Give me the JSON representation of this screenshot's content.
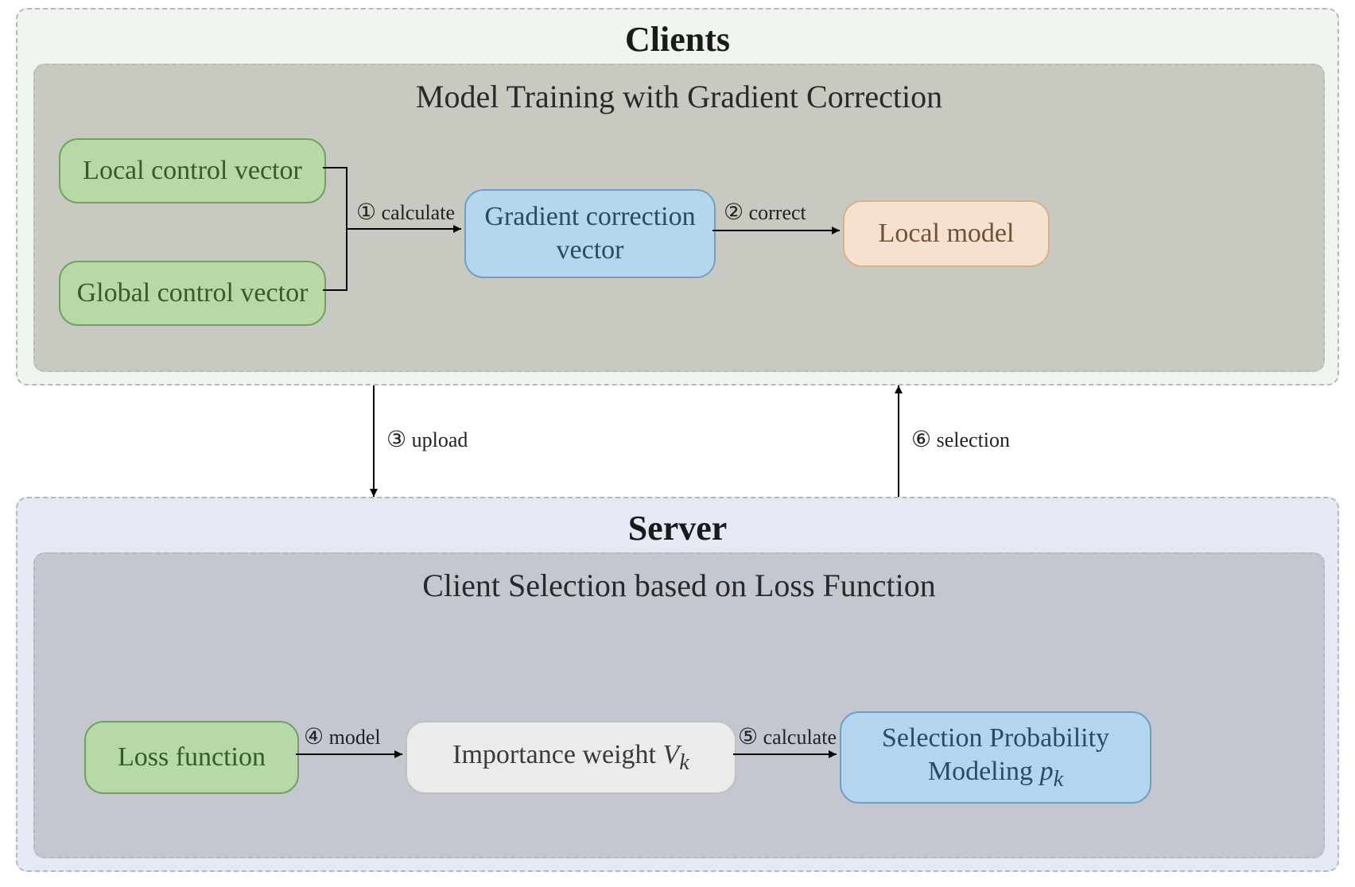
{
  "sections": {
    "clients": {
      "title": "Clients",
      "panel_title": "Model Training with Gradient Correction",
      "nodes": {
        "local_cv": "Local control vector",
        "global_cv": "Global control vector",
        "grad_vec_l1": "Gradient correction",
        "grad_vec_l2": "vector",
        "local_model": "Local model"
      }
    },
    "server": {
      "title": "Server",
      "panel_title": "Client Selection based on Loss Function",
      "nodes": {
        "loss": "Loss function",
        "importance_prefix": "Importance weight ",
        "importance_var": "V",
        "importance_sub": "k",
        "selprob_l1": "Selection Probability",
        "selprob_l2_prefix": "Modeling ",
        "selprob_var": "p",
        "selprob_sub": "k"
      }
    }
  },
  "edges": {
    "step1": {
      "num": "①",
      "label": "calculate"
    },
    "step2": {
      "num": "②",
      "label": "correct"
    },
    "step3": {
      "num": "③",
      "label": "upload"
    },
    "step4": {
      "num": "④",
      "label": "model"
    },
    "step5": {
      "num": "⑤",
      "label": "calculate"
    },
    "step6": {
      "num": "⑥",
      "label": "selection"
    }
  }
}
